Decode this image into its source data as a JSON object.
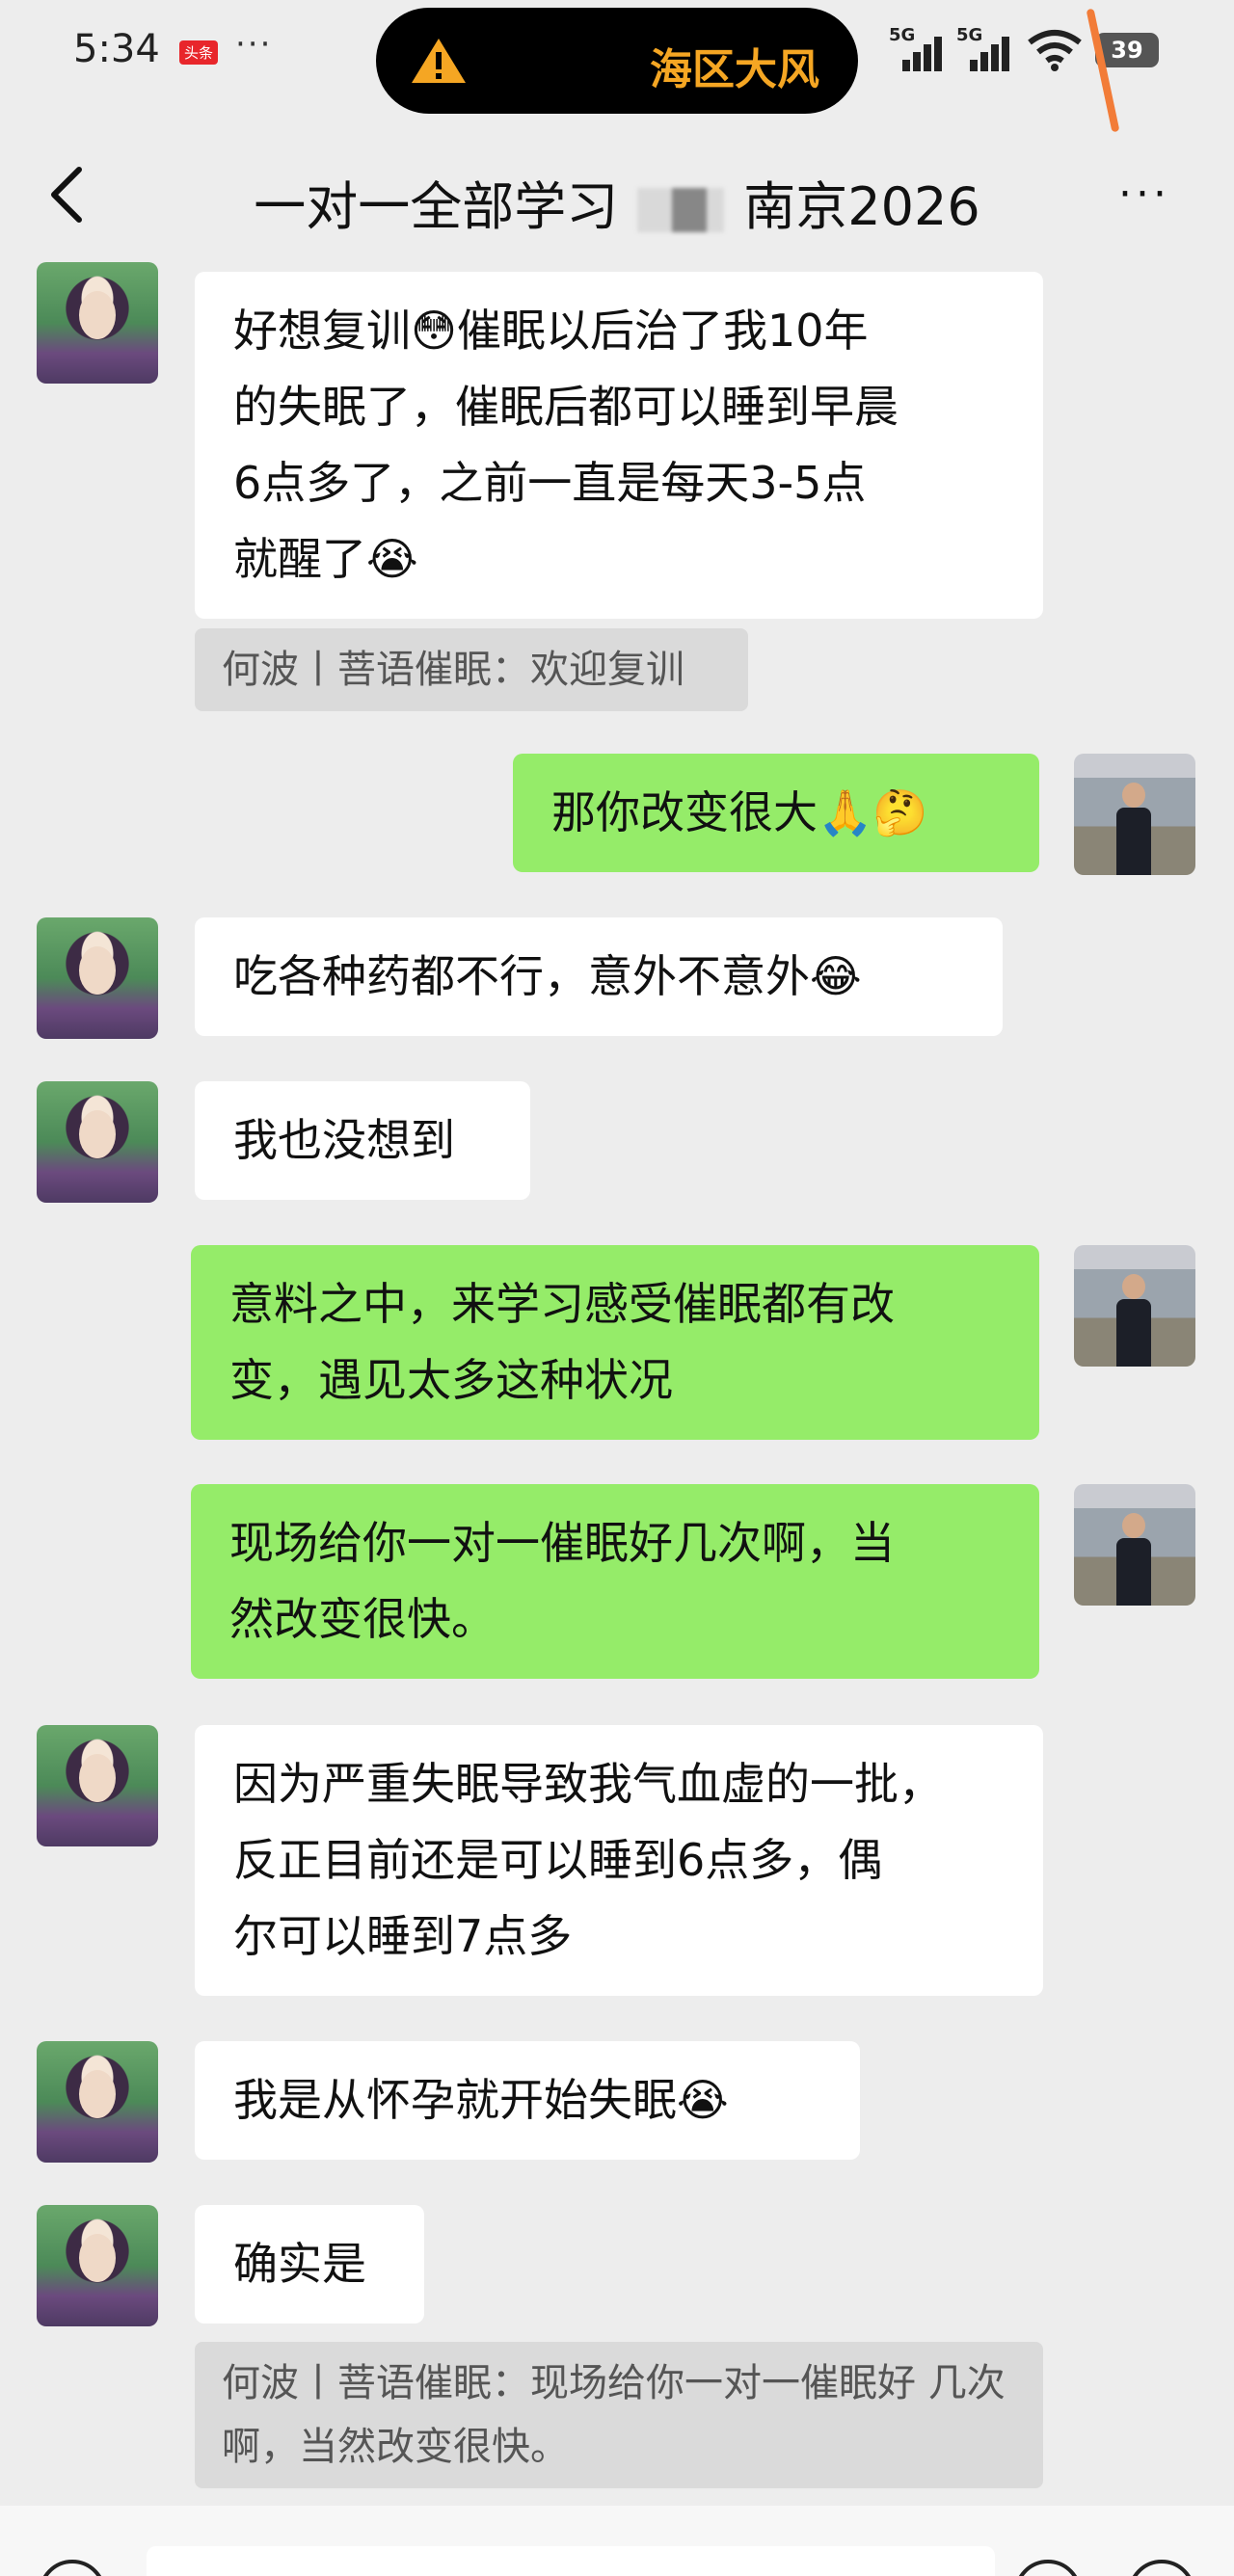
{
  "status_bar": {
    "time": "5:34",
    "news_badge": "头条",
    "more": "···",
    "weather_alert": "海区大风",
    "network_1": "5G",
    "network_2": "5G",
    "battery": "39",
    "warning_color": "#f5a623",
    "icons": [
      "warning-icon",
      "signal-icon",
      "wifi-icon",
      "battery-icon"
    ]
  },
  "nav": {
    "title_left": "一对一全部学习",
    "title_right": "南京2026",
    "menu": "···"
  },
  "colors": {
    "background": "#ededed",
    "incoming_bubble": "#ffffff",
    "outgoing_bubble": "#95ec69",
    "quote_bg": "#dadada"
  },
  "messages": [
    {
      "side": "in",
      "text": "好想复训😳催眠以后治了我10年\n的失眠了，催眠后都可以睡到早晨\n6点多了，之前一直是每天3-5点\n就醒了😭"
    },
    {
      "side": "quote",
      "text": "何波丨菩语催眠：欢迎复训"
    },
    {
      "side": "out",
      "text": "那你改变很大🙏🤔"
    },
    {
      "side": "in",
      "text": "吃各种药都不行，意外不意外😂"
    },
    {
      "side": "in",
      "text": "我也没想到"
    },
    {
      "side": "out",
      "text": "意料之中，来学习感受催眠都有改\n变，遇见太多这种状况"
    },
    {
      "side": "out",
      "text": "现场给你一对一催眠好几次啊，当\n然改变很快。"
    },
    {
      "side": "in",
      "text": "因为严重失眠导致我气血虚的一批，\n反正目前还是可以睡到6点多，偶\n尔可以睡到7点多"
    },
    {
      "side": "in",
      "text": "我是从怀孕就开始失眠😭"
    },
    {
      "side": "in",
      "text": "确实是"
    },
    {
      "side": "quote",
      "text": "何波丨菩语催眠：现场给你一对一催眠好\n几次啊，当然改变很快。"
    }
  ]
}
